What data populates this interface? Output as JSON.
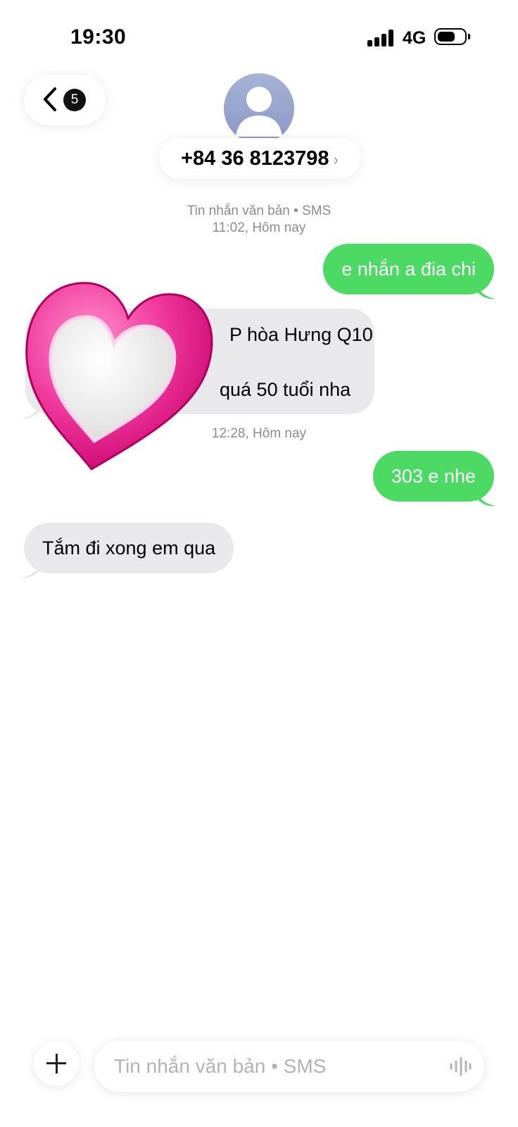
{
  "status_bar": {
    "time": "19:30",
    "network": "4G"
  },
  "header": {
    "back_count": "5",
    "contact_number": "+84 36 8123798",
    "chevron": "›"
  },
  "conversation": {
    "meta_type": "Tin nhắn văn bản • SMS",
    "meta_time_1": "11:02, Hôm nay",
    "msg_out_1": "e nhắn a đia chi",
    "msg_in_1_line1": "P hòa Hưng Q10",
    "msg_in_1_line2": "quá 50 tuổi nha",
    "meta_time_2": "12:28, Hôm nay",
    "msg_out_2": "303 e nhe",
    "msg_in_2": "Tắm đi xong em qua"
  },
  "composer": {
    "placeholder": "Tin nhắn văn bản • SMS"
  },
  "colors": {
    "outgoing": "#4cd964",
    "incoming": "#e9e9eb",
    "sticker": "#e0157f"
  },
  "icons": [
    "back-chevron-icon",
    "avatar-person-icon",
    "heart-sticker",
    "plus-icon",
    "voice-wave-icon"
  ]
}
